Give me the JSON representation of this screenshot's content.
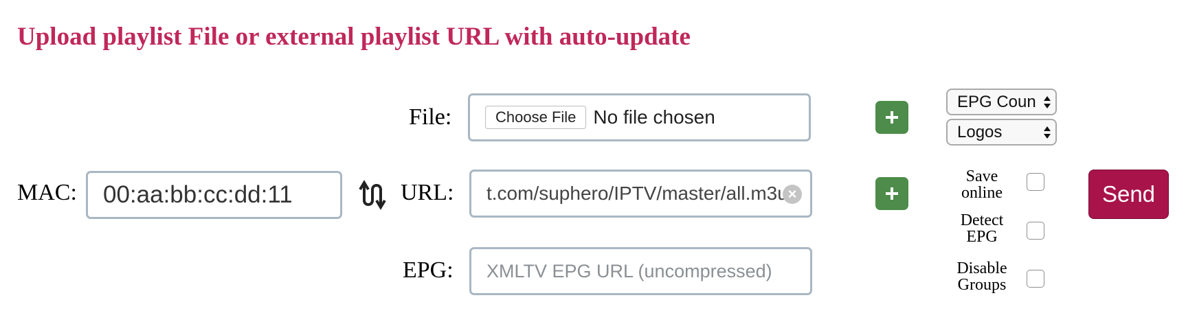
{
  "title": "Upload playlist File or external playlist URL with auto-update",
  "mac": {
    "label": "MAC:",
    "value": "00:aa:bb:cc:dd:11"
  },
  "file": {
    "label": "File:",
    "button_label": "Choose File",
    "status": "No file chosen"
  },
  "url": {
    "label": "URL:",
    "value": "t.com/suphero/IPTV/master/all.m3u"
  },
  "epg": {
    "label": "EPG:",
    "placeholder": "XMLTV EPG URL (uncompressed)"
  },
  "selects": {
    "epg_country": "EPG Coun",
    "logos": "Logos"
  },
  "options": {
    "save_online": {
      "line1": "Save",
      "line2": "online"
    },
    "detect_epg": {
      "line1": "Detect",
      "line2": "EPG"
    },
    "disable_groups": {
      "line1": "Disable",
      "line2": "Groups"
    }
  },
  "send_label": "Send",
  "colors": {
    "title": "#c0285a",
    "plus_button": "#4d8c4a",
    "send_button": "#a8134a",
    "input_border": "#a9b7c3"
  }
}
